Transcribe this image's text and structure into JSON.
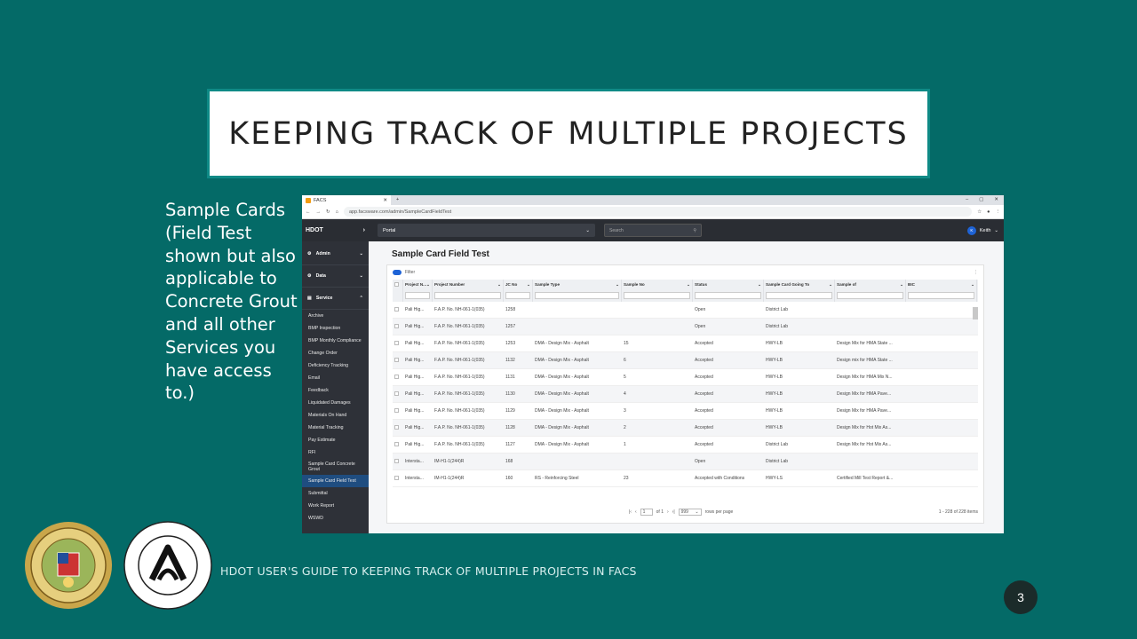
{
  "slide": {
    "title": "KEEPING TRACK OF MULTIPLE PROJECTS",
    "side_text": "Sample Cards (Field Test shown but also applicable to Concrete Grout and all other Services you have access to.)",
    "footer": "HDOT USER'S GUIDE TO KEEPING TRACK OF MULTIPLE PROJECTS IN FACS",
    "page_number": "3"
  },
  "browser": {
    "tab_title": "FACS",
    "url": "app.facsware.com/admin/SampleCardFieldTest",
    "new_tab": "+",
    "controls": [
      "–",
      "▢",
      "✕"
    ]
  },
  "app": {
    "brand": "HDOT",
    "portal": "Portal",
    "search_placeholder": "Search",
    "user_initial": "K",
    "user_name": "Keith",
    "page_title": "Sample Card Field Test",
    "filter_label": "Filter"
  },
  "sidebar": {
    "groups": [
      "Admin",
      "Data",
      "Service"
    ],
    "items": [
      "Archive",
      "BMP Inspection",
      "BMP Monthly Compliance",
      "Change Order",
      "Deficiency Tracking",
      "Email",
      "Feedback",
      "Liquidated Damages",
      "Materials On Hand",
      "Material Tracking",
      "Pay Estimate",
      "RFI",
      "Sample Card Concrete Grout",
      "Sample Card Field Test",
      "Submittal",
      "Work Report",
      "WSWD"
    ],
    "active": "Sample Card Field Test"
  },
  "table": {
    "columns": [
      "Project N...",
      "Project Number",
      "JC No",
      "Sample Type",
      "Sample No",
      "Status",
      "Sample Card Going To",
      "Sample of",
      "BIC"
    ],
    "rows": [
      [
        "Pali Hig...",
        "F.A.P. No. NH-061-1(035)",
        "1258",
        "",
        "",
        "Open",
        "District Lab",
        "",
        ""
      ],
      [
        "Pali Hig...",
        "F.A.P. No. NH-061-1(035)",
        "1257",
        "",
        "",
        "Open",
        "District Lab",
        "",
        ""
      ],
      [
        "Pali Hig...",
        "F.A.P. No. NH-061-1(035)",
        "1253",
        "DMA - Design Mix - Asphalt",
        "15",
        "Accepted",
        "HWY-LB",
        "Design Mix for HMA State ...",
        ""
      ],
      [
        "Pali Hig...",
        "F.A.P. No. NH-061-1(035)",
        "1132",
        "DMA - Design Mix - Asphalt",
        "6",
        "Accepted",
        "HWY-LB",
        "Design mix for HMA State ...",
        ""
      ],
      [
        "Pali Hig...",
        "F.A.P. No. NH-061-1(035)",
        "1131",
        "DMA - Design Mix - Asphalt",
        "5",
        "Accepted",
        "HWY-LB",
        "Design Mix for HMA Mix N...",
        ""
      ],
      [
        "Pali Hig...",
        "F.A.P. No. NH-061-1(035)",
        "1130",
        "DMA - Design Mix - Asphalt",
        "4",
        "Accepted",
        "HWY-LB",
        "Design Mix for HMA Pave...",
        ""
      ],
      [
        "Pali Hig...",
        "F.A.P. No. NH-061-1(035)",
        "1129",
        "DMA - Design Mix - Asphalt",
        "3",
        "Accepted",
        "HWY-LB",
        "Design Mix for HMA Pave...",
        ""
      ],
      [
        "Pali Hig...",
        "F.A.P. No. NH-061-1(035)",
        "1128",
        "DMA - Design Mix - Asphalt",
        "2",
        "Accepted",
        "HWY-LB",
        "Design Mix for Hot Mix As...",
        ""
      ],
      [
        "Pali Hig...",
        "F.A.P. No. NH-061-1(035)",
        "1127",
        "DMA - Design Mix - Asphalt",
        "1",
        "Accepted",
        "District Lab",
        "Design Mix for Hot Mix As...",
        ""
      ],
      [
        "Intersta...",
        "IM-H1-1(244)R",
        "168",
        "",
        "",
        "Open",
        "District Lab",
        "",
        ""
      ],
      [
        "Intersta...",
        "IM-H1-1(244)R",
        "160",
        "RS - Reinforcing Steel",
        "23",
        "Accepted with Conditions",
        "HWY-LS",
        "Certified Mill Test Report &...",
        ""
      ]
    ]
  },
  "pager": {
    "page": "1",
    "of": "of 1",
    "page_size": "999",
    "rows_per_page": "rows per page",
    "count": "1 - 228 of 228 items"
  }
}
